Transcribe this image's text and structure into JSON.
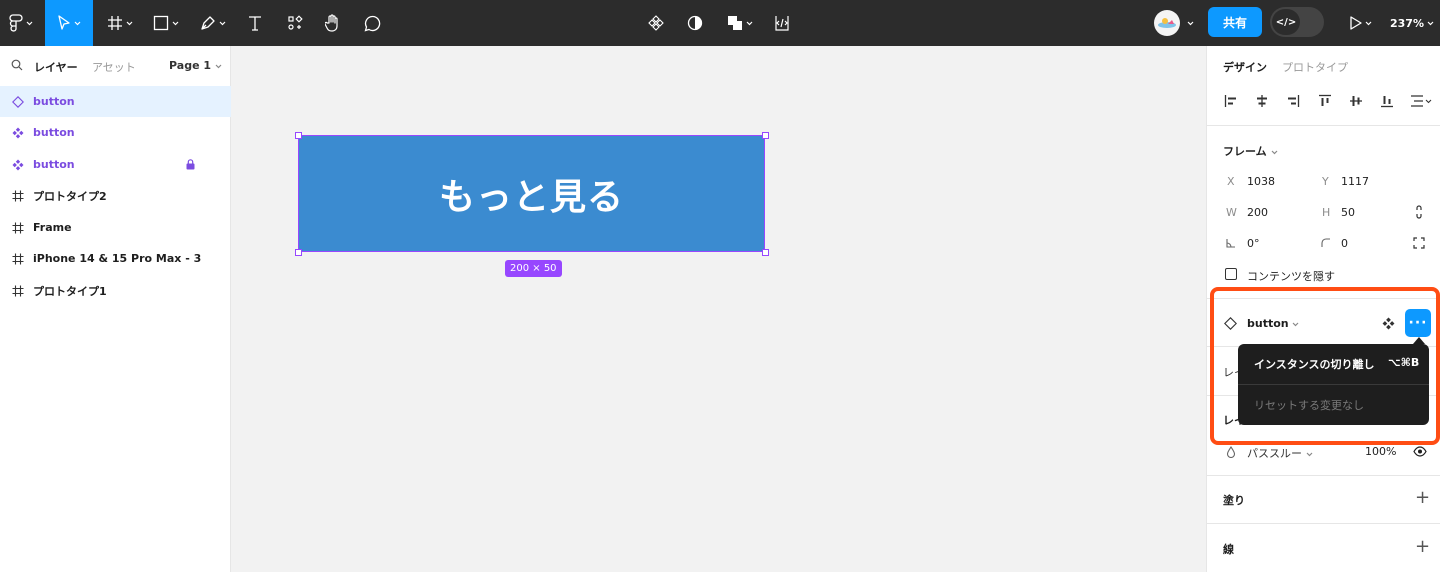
{
  "toolbar": {
    "share_label": "共有",
    "dev_mode_label": "</>",
    "zoom_label": "237%",
    "icons": [
      "figma-menu-icon",
      "move-tool-icon",
      "frame-tool-icon",
      "shape-tool-icon",
      "pen-tool-icon",
      "text-tool-icon",
      "resources-icon",
      "hand-tool-icon",
      "comment-tool-icon",
      "component-icon",
      "mask-icon",
      "boolean-icon",
      "code-icon",
      "play-icon"
    ]
  },
  "left_panel": {
    "tab_layers": "レイヤー",
    "tab_assets": "アセット",
    "page": "Page 1",
    "layers": [
      {
        "name": "button",
        "kind": "component-set"
      },
      {
        "name": "button",
        "kind": "component"
      },
      {
        "name": "button",
        "kind": "component",
        "locked": true
      },
      {
        "name": "プロトタイプ2",
        "kind": "frame"
      },
      {
        "name": "Frame",
        "kind": "frame"
      },
      {
        "name": "iPhone 14 & 15 Pro Max - 3",
        "kind": "frame"
      },
      {
        "name": "プロトタイプ1",
        "kind": "frame"
      }
    ]
  },
  "canvas": {
    "button_text": "もっと見る",
    "size_label": "200 × 50",
    "button_color": "#3b8bd0",
    "selection_color": "#9747ff"
  },
  "right_panel": {
    "tab_design": "デザイン",
    "tab_prototype": "プロトタイプ",
    "frame_section": "フレーム",
    "x_label": "X",
    "x_value": "1038",
    "y_label": "Y",
    "y_value": "1117",
    "w_label": "W",
    "w_value": "200",
    "h_label": "H",
    "h_value": "50",
    "rotation_value": "0°",
    "radius_value": "0",
    "clip_label": "コンテンツを隠す",
    "component_name": "button",
    "layer_section_prefix": "レイ",
    "blend_mode": "パススルー",
    "opacity": "100%",
    "fill_label": "塗り",
    "stroke_label": "線"
  },
  "context_menu": {
    "item1": "インスタンスの切り離し",
    "item1_shortcut": "⌥⌘B",
    "item2": "リセットする変更なし"
  },
  "colors": {
    "accent": "#0d99ff",
    "highlight": "#ff4d14"
  }
}
